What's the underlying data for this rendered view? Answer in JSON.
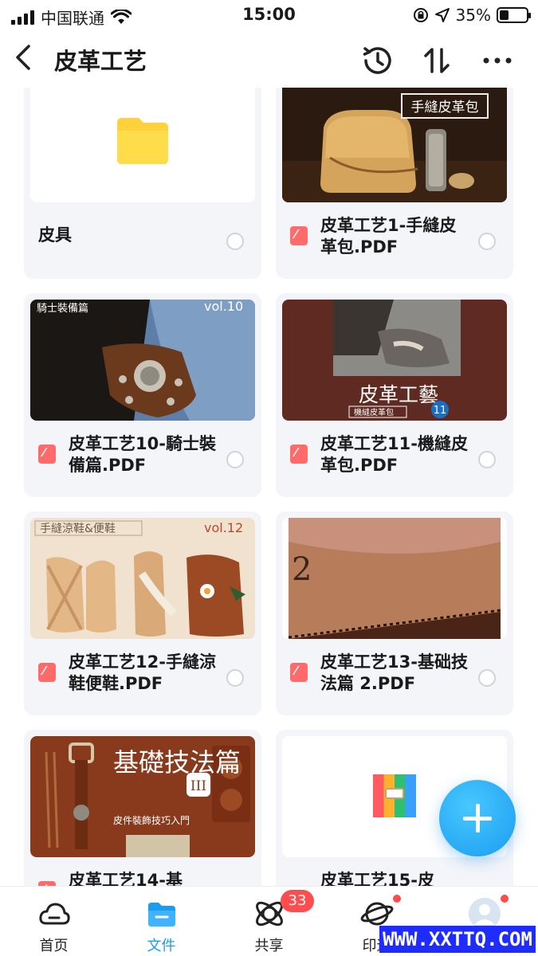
{
  "status_bar": {
    "carrier": "中国联通",
    "time": "15:00",
    "battery": "35%",
    "battery_level": 0.35,
    "icons": [
      "signal-icon",
      "wifi-icon",
      "lock-rotation-icon",
      "location-icon",
      "battery-icon"
    ]
  },
  "header": {
    "title": "皮革工艺",
    "icons": [
      "back-icon",
      "history-icon",
      "sort-icon",
      "more-icon"
    ]
  },
  "files": [
    {
      "name": "皮具",
      "type": "folder",
      "thumb_text": ""
    },
    {
      "name": "皮革工艺1-手縫皮革包.PDF",
      "type": "pdf",
      "thumb_text": "手縫皮革包"
    },
    {
      "name": "皮革工艺10-騎士裝備篇.PDF",
      "type": "pdf",
      "thumb_text": "騎士裝備篇"
    },
    {
      "name": "皮革工艺11-機縫皮革包.PDF",
      "type": "pdf",
      "thumb_text": "皮革工藝"
    },
    {
      "name": "皮革工艺12-手縫涼鞋便鞋.PDF",
      "type": "pdf",
      "thumb_text": "手縫涼鞋&便鞋"
    },
    {
      "name": "皮革工艺13-基础技法篇 2.PDF",
      "type": "pdf",
      "thumb_text": ""
    },
    {
      "name": "皮革工艺14-基",
      "type": "pdf",
      "thumb_text": "基礎技法篇"
    },
    {
      "name": "皮革工艺15-皮",
      "type": "archive",
      "thumb_text": ""
    }
  ],
  "thumb_extras": {
    "vol_11": "11",
    "sub_11": "機縫皮革包",
    "vol_12": "vol.12",
    "vol_10": "vol.10",
    "roman_14": "III",
    "sub_14": "皮件裝飾技巧入門"
  },
  "tabs": [
    {
      "label": "首页",
      "icon": "cloud-icon",
      "active": false
    },
    {
      "label": "文件",
      "icon": "folder-icon",
      "active": true
    },
    {
      "label": "共享",
      "icon": "share-icon",
      "active": false,
      "badge": "33"
    },
    {
      "label": "印迹",
      "icon": "planet-icon",
      "active": false,
      "dot": true
    },
    {
      "label": "我的",
      "icon": "avatar-icon",
      "active": false,
      "dot": true
    }
  ],
  "watermark": "WWW.XXTTQ.COM",
  "colors": {
    "accent": "#1a9cf0",
    "badge": "#ff4d4f",
    "pdf": "#ff6b6b",
    "folder": "#ffd23c"
  }
}
